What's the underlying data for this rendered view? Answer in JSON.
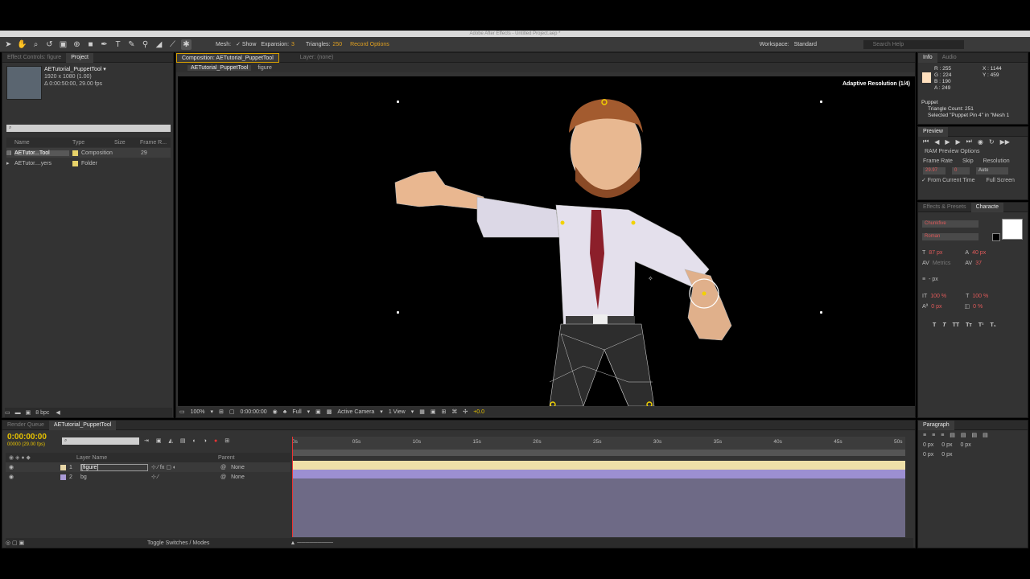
{
  "title_bar": "Adobe After Effects - Untitled Project.aep *",
  "toolbar": {
    "mesh_label": "Mesh:",
    "show_label": "✓ Show",
    "expansion_label": "Expansion:",
    "expansion_value": "3",
    "triangles_label": "Triangles:",
    "triangles_value": "250",
    "record_options": "Record Options",
    "workspace_label": "Workspace:",
    "workspace_value": "Standard",
    "search_placeholder": "Search Help"
  },
  "project_panel": {
    "tabs": [
      "Effect Controls: figure",
      "Project"
    ],
    "item_name": "AETutorial_PuppetTool ▾",
    "item_dims": "1920 x 1080 (1.00)",
    "item_duration": "Δ 0:00:50:00, 29.00 fps",
    "columns": [
      "Name",
      "Type",
      "Size",
      "Frame R..."
    ],
    "rows": [
      {
        "name": "AETutor...Tool",
        "type": "Composition",
        "size": "",
        "fps": "29",
        "color": "#e7d26a"
      },
      {
        "name": "AETutor....yers",
        "type": "Folder",
        "size": "",
        "fps": "",
        "color": "#e7d26a"
      }
    ],
    "bpc": "8 bpc"
  },
  "comp_panel": {
    "tab_main": "Composition: AETutorial_PuppetTool",
    "tab_layer": "Layer: (none)",
    "breadcrumb_comp": "AETutorial_PuppetTool",
    "breadcrumb_layer": "figure",
    "adaptive_resolution": "Adaptive Resolution (1/4)",
    "zoom": "100%",
    "timecode": "0:00:00:00",
    "resolution": "Full",
    "camera": "Active Camera",
    "views": "1 View",
    "exposure": "+0.0"
  },
  "info_panel": {
    "tabs": [
      "Info",
      "Audio"
    ],
    "r": "R : 255",
    "g": "G : 224",
    "b": "B : 190",
    "a": "A : 249",
    "x": "X : 1144",
    "y": "Y : 459",
    "swatch_color": "#ffe0be",
    "puppet_title": "Puppet",
    "triangle_count": "Triangle Count: 251",
    "selected": "Selected \"Puppet Pin 4\" in \"Mesh 1"
  },
  "preview_panel": {
    "tab": "Preview",
    "ram_options": "RAM Preview Options",
    "frame_rate_label": "Frame Rate",
    "skip_label": "Skip",
    "resolution_label": "Resolution",
    "frame_rate_value": "29.97",
    "skip_value": "0",
    "resolution_value": "Auto",
    "from_current": "✓ From Current Time",
    "full_screen": "Full Screen"
  },
  "character_panel": {
    "tabs": [
      "Effects & Presets",
      "Characte"
    ],
    "font": "Chunkfive",
    "style": "Roman",
    "size": "87 px",
    "leading": "40 px",
    "kerning": "Metrics",
    "tracking": "37",
    "stroke": "- px",
    "vscale": "100 %",
    "hscale": "100 %",
    "baseline": "0 px",
    "tsume": "0 %",
    "styles": [
      "T",
      "T",
      "TT",
      "Tᴛ",
      "T¹",
      "T₁"
    ]
  },
  "paragraph_panel": {
    "tab": "Paragraph",
    "indents": [
      "0 px",
      "0 px",
      "0 px",
      "0 px",
      "0 px"
    ]
  },
  "timeline": {
    "tabs": [
      "Render Queue",
      "AETutorial_PuppetTool"
    ],
    "timecode": "0:00:00:00",
    "fps_info": "00000 (29.00 fps)",
    "ruler": [
      "0s",
      "05s",
      "10s",
      "15s",
      "20s",
      "25s",
      "30s",
      "35s",
      "40s",
      "45s",
      "50s"
    ],
    "col_layer_name": "Layer Name",
    "col_parent": "Parent",
    "layers": [
      {
        "num": "1",
        "name": "[figure]",
        "parent": "None",
        "color": "#e7d6a6"
      },
      {
        "num": "2",
        "name": "bg",
        "parent": "None",
        "color": "#a99ad6"
      }
    ],
    "toggle": "Toggle Switches / Modes"
  },
  "colors": {
    "accent": "#e7c200",
    "track": "#6e6a86",
    "figure_bar": "#eedfa8",
    "bg_bar": "#9c8fd2"
  }
}
